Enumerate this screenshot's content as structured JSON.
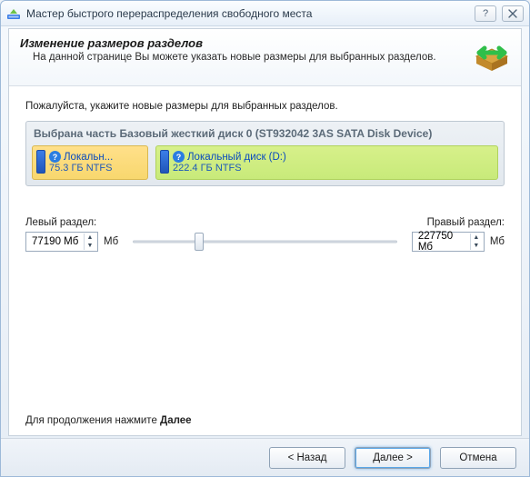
{
  "window": {
    "title": "Мастер быстрого перераспределения свободного места"
  },
  "header": {
    "title": "Изменение размеров разделов",
    "subtitle": "На данной странице Вы можете указать новые размеры для выбранных разделов."
  },
  "instruction": "Пожалуйста, укажите новые размеры для выбранных разделов.",
  "diskgroup_title": "Выбрана часть Базовый жесткий диск 0 (ST932042 3AS SATA Disk Device)",
  "partitions": {
    "left": {
      "name": "Локальн...",
      "size": "75.3 ГБ NTFS"
    },
    "right": {
      "name": "Локальный диск (D:)",
      "size": "222.4 ГБ NTFS"
    }
  },
  "slider": {
    "left_label": "Левый раздел:",
    "right_label": "Правый раздел:",
    "left_value": "77190 Мб",
    "right_value": "227750 Мб",
    "unit": "Мб"
  },
  "continue_prefix": "Для продолжения нажмите ",
  "continue_bold": "Далее",
  "footer": {
    "back": "< Назад",
    "next": "Далее >",
    "cancel": "Отмена"
  }
}
